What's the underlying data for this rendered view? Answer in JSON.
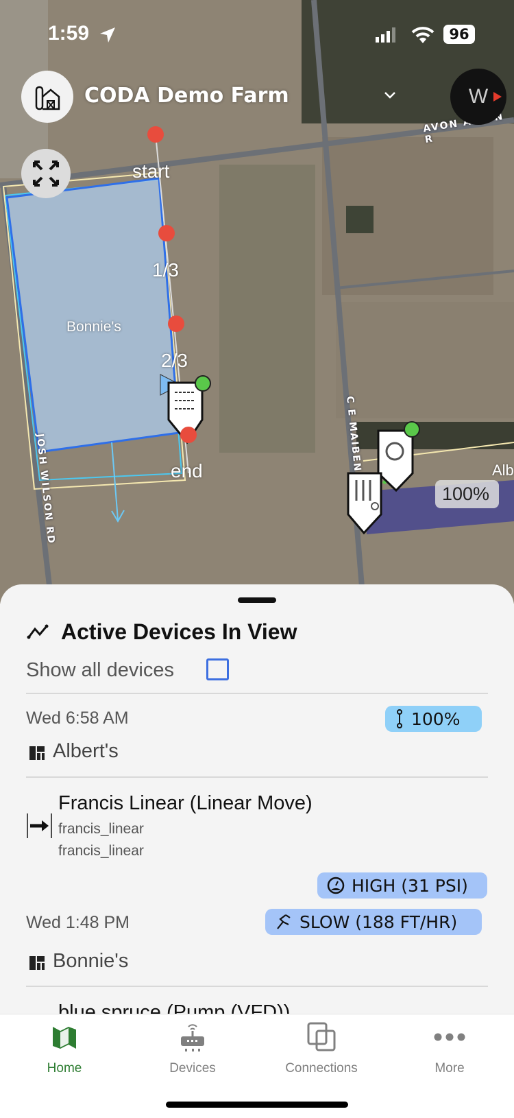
{
  "status_bar": {
    "time": "1:59",
    "battery": "96"
  },
  "header": {
    "farm_name": "CODA Demo Farm",
    "compass_letter": "W"
  },
  "map": {
    "field_labels": [
      "Bonnie's",
      "Alb"
    ],
    "road_labels": [
      "AVON ALLEN R",
      "C E MAIBEN",
      "JOSH WILSON RD"
    ],
    "pin_labels": [
      "start",
      "1/3",
      "2/3",
      "end"
    ],
    "progress_label": "100%",
    "colors": {
      "field_fill": "#a9c3df",
      "field_border": "#2f6fe8",
      "pin": "#e84c3d",
      "online": "#5ac84a",
      "purple_band": "#4b4a8e"
    }
  },
  "sheet": {
    "title": "Active Devices In View",
    "show_all_label": "Show all devices",
    "show_all_checked": false,
    "entries": [
      {
        "time": "Wed 6:58 AM",
        "badge": "100%",
        "badge_icon": "valve-icon",
        "field": "Albert's"
      },
      {
        "device_name": "Francis Linear (Linear Move)",
        "sub1": "francis_linear",
        "sub2": "francis_linear",
        "pressure_badge": "HIGH (31 PSI)",
        "speed_badge": "SLOW (188 FT/HR)",
        "time": "Wed 1:48 PM",
        "field": "Bonnie's"
      },
      {
        "device_name": "blue spruce (Pump (VFD))"
      }
    ],
    "colors": {
      "badge_light": "#8fd0f8",
      "badge_blue": "#a4c4f8",
      "checkbox": "#3d6fe0"
    }
  },
  "tabs": [
    {
      "label": "Home",
      "icon": "map-icon",
      "active": true
    },
    {
      "label": "Devices",
      "icon": "router-icon",
      "active": false
    },
    {
      "label": "Connections",
      "icon": "connections-icon",
      "active": false
    },
    {
      "label": "More",
      "icon": "more-icon",
      "active": false
    }
  ],
  "colors": {
    "active_tab": "#2e7d32",
    "inactive_tab": "#808080"
  }
}
